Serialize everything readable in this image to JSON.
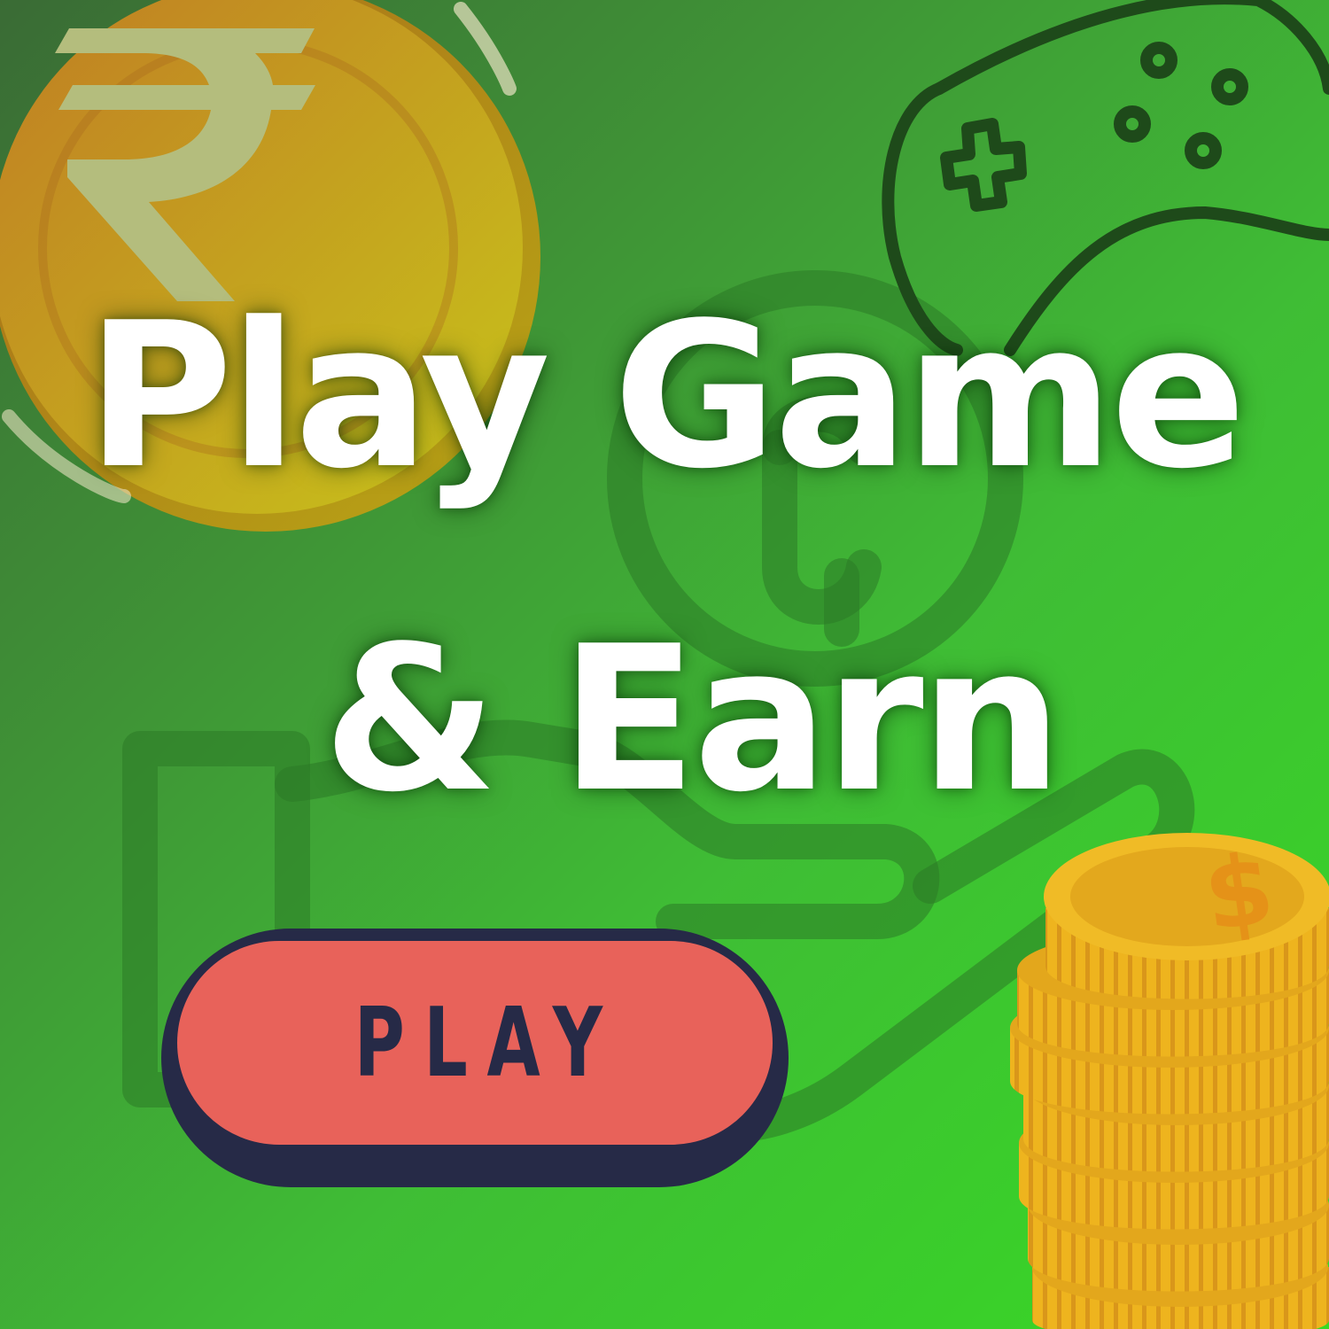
{
  "headline": {
    "line1": "Play Game",
    "line2": "& Earn"
  },
  "button": {
    "label": "PLAY"
  },
  "icons": {
    "top_left": "rupee-coin-icon",
    "top_right": "game-controller-icon",
    "center_background": "hand-holding-dollar-icon",
    "bottom_right": "gold-coin-stack-icon"
  },
  "colors": {
    "background_dark": "#3a6b35",
    "background_light": "#37d924",
    "coin_gold": "#e8b523",
    "button_fill": "#e8625a",
    "button_border": "#262a47",
    "headline_text": "#ffffff",
    "icon_outline": "#1f4d1c"
  }
}
